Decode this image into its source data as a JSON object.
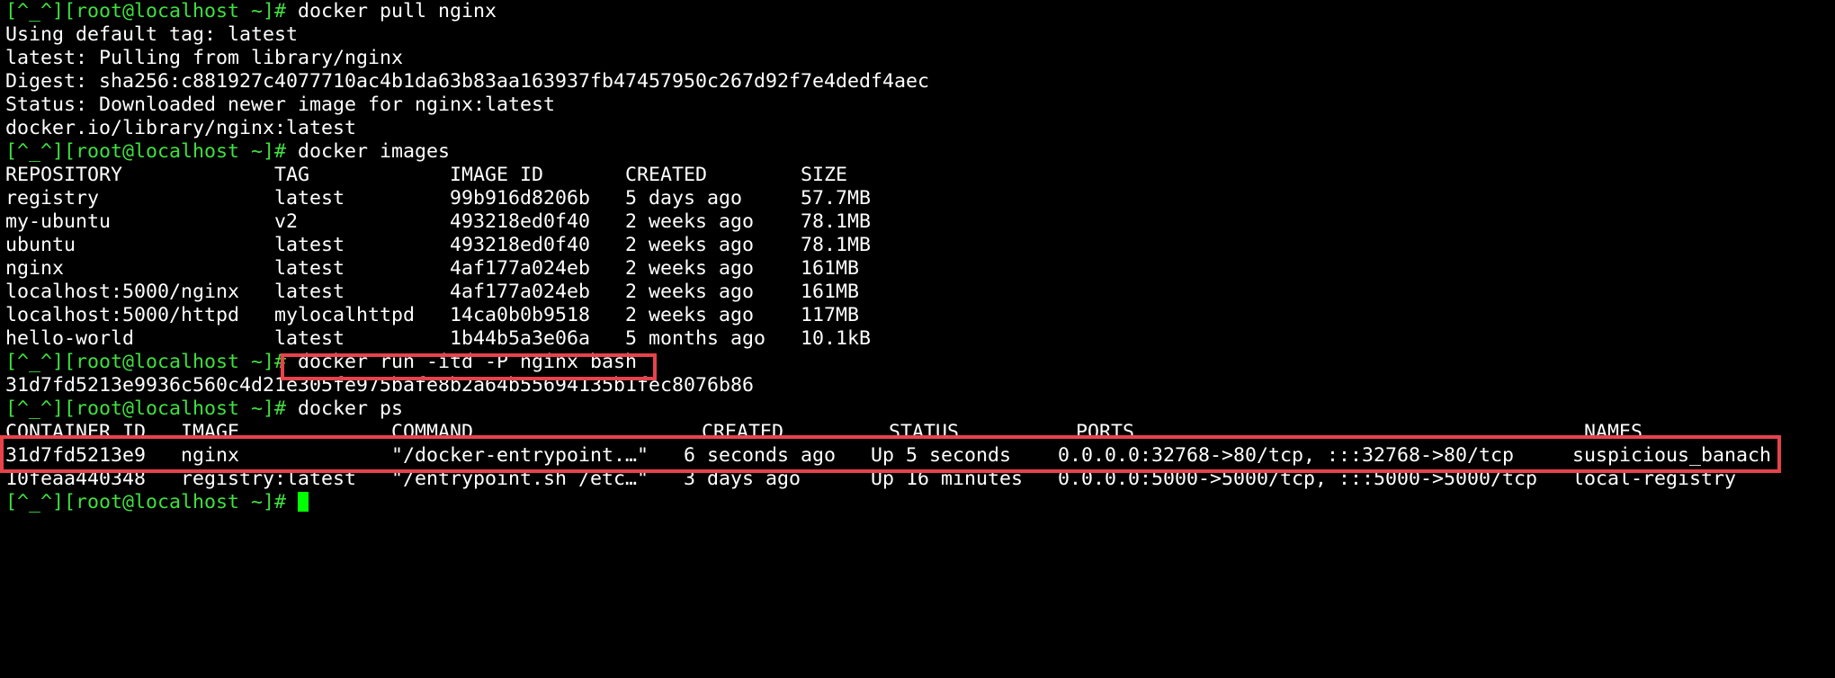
{
  "terminal": {
    "prompt": "[^_^][root@localhost ~]#",
    "colors": {
      "background": "#000000",
      "text": "#ffffff",
      "prompt": "#3fe03f",
      "cursor": "#00ff00",
      "highlight": "#e8424b"
    },
    "pull": {
      "command": "docker pull nginx",
      "output": [
        "Using default tag: latest",
        "latest: Pulling from library/nginx",
        "Digest: sha256:c881927c4077710ac4b1da63b83aa163937fb47457950c267d92f7e4dedf4aec",
        "Status: Downloaded newer image for nginx:latest",
        "docker.io/library/nginx:latest"
      ]
    },
    "images": {
      "command": "docker images",
      "headers": [
        "REPOSITORY",
        "TAG",
        "IMAGE ID",
        "CREATED",
        "SIZE"
      ],
      "rows": [
        [
          "registry",
          "latest",
          "99b916d8206b",
          "5 days ago",
          "57.7MB"
        ],
        [
          "my-ubuntu",
          "v2",
          "493218ed0f40",
          "2 weeks ago",
          "78.1MB"
        ],
        [
          "ubuntu",
          "latest",
          "493218ed0f40",
          "2 weeks ago",
          "78.1MB"
        ],
        [
          "nginx",
          "latest",
          "4af177a024eb",
          "2 weeks ago",
          "161MB"
        ],
        [
          "localhost:5000/nginx",
          "latest",
          "4af177a024eb",
          "2 weeks ago",
          "161MB"
        ],
        [
          "localhost:5000/httpd",
          "mylocalhttpd",
          "14ca0b0b9518",
          "2 weeks ago",
          "117MB"
        ],
        [
          "hello-world",
          "latest",
          "1b44b5a3e06a",
          "5 months ago",
          "10.1kB"
        ]
      ]
    },
    "run": {
      "command": "docker run -itd -P nginx bash",
      "output": "31d7fd5213e9936c560c4d21e305fe975bafe8b2a64b55694135b1fec8076b86"
    },
    "ps": {
      "command": "docker ps",
      "headers": [
        "CONTAINER ID",
        "IMAGE",
        "COMMAND",
        "CREATED",
        "STATUS",
        "PORTS",
        "NAMES"
      ],
      "rows": [
        [
          "31d7fd5213e9",
          "nginx",
          "\"/docker-entrypoint.…\"",
          "6 seconds ago",
          "Up 5 seconds",
          "0.0.0.0:32768->80/tcp, :::32768->80/tcp",
          "suspicious_banach"
        ],
        [
          "10feaa440348",
          "registry:latest",
          "\"/entrypoint.sh /etc…\"",
          "3 days ago",
          "Up 16 minutes",
          "0.0.0.0:5000->5000/tcp, :::5000->5000/tcp",
          "local-registry"
        ]
      ]
    }
  }
}
